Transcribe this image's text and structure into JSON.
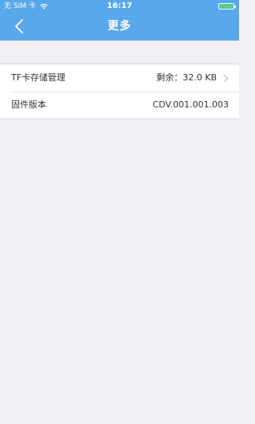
{
  "status_bar": {
    "carrier": "无 SIM 卡",
    "time": "16:17"
  },
  "nav": {
    "title": "更多"
  },
  "settings": {
    "items": [
      {
        "label": "TF卡存储管理",
        "value": "剩余：32.0 KB",
        "has_chevron": true
      },
      {
        "label": "固件版本",
        "value": "CDV.001.001.003",
        "has_chevron": false
      }
    ]
  },
  "colors": {
    "header_bg": "#5aa8ec",
    "page_bg": "#efeff4",
    "battery": "#4cd964"
  },
  "icons": {
    "back": "back-chevron-icon",
    "wifi": "wifi-icon",
    "battery": "battery-icon",
    "disclosure": "chevron-right-icon"
  }
}
